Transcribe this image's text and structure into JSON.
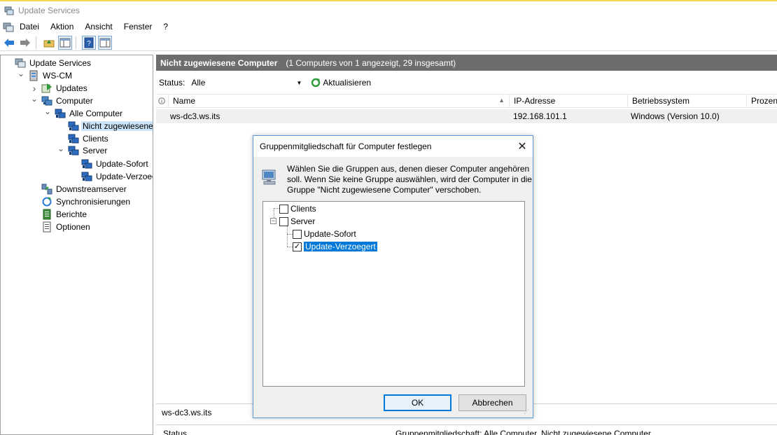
{
  "window": {
    "title": "Update Services"
  },
  "menu": [
    "Datei",
    "Aktion",
    "Ansicht",
    "Fenster",
    "?"
  ],
  "tree": {
    "items": [
      {
        "label": "Update Services",
        "depth": 0,
        "expander": "",
        "icon": "server-console-icon"
      },
      {
        "label": "WS-CM",
        "depth": 1,
        "expander": "expanded",
        "icon": "server-icon"
      },
      {
        "label": "Updates",
        "depth": 2,
        "expander": "collapsed",
        "icon": "updates-icon"
      },
      {
        "label": "Computer",
        "depth": 2,
        "expander": "expanded",
        "icon": "computers-icon"
      },
      {
        "label": "Alle Computer",
        "depth": 3,
        "expander": "expanded",
        "icon": "computer-group-icon"
      },
      {
        "label": "Nicht zugewiesene Co",
        "depth": 4,
        "expander": "",
        "icon": "computer-group-icon",
        "selected": true
      },
      {
        "label": "Clients",
        "depth": 4,
        "expander": "",
        "icon": "computer-group-icon"
      },
      {
        "label": "Server",
        "depth": 4,
        "expander": "expanded",
        "icon": "computer-group-icon",
        "offset": -1
      },
      {
        "label": "Update-Sofort",
        "depth": 5,
        "expander": "",
        "icon": "computer-group-icon"
      },
      {
        "label": "Update-Verzoegert",
        "depth": 5,
        "expander": "",
        "icon": "computer-group-icon"
      },
      {
        "label": "Downstreamserver",
        "depth": 2,
        "expander": "",
        "icon": "downstream-icon"
      },
      {
        "label": "Synchronisierungen",
        "depth": 2,
        "expander": "",
        "icon": "sync-icon"
      },
      {
        "label": "Berichte",
        "depth": 2,
        "expander": "",
        "icon": "reports-icon"
      },
      {
        "label": "Optionen",
        "depth": 2,
        "expander": "",
        "icon": "options-icon"
      }
    ]
  },
  "pane": {
    "title": "Nicht zugewiesene Computer",
    "subtitle": "(1 Computers von 1 angezeigt, 29 insgesamt)",
    "status_label": "Status:",
    "status_value": "Alle",
    "refresh_label": "Aktualisieren",
    "columns": [
      "Name",
      "IP-Adresse",
      "Betriebssystem",
      "Prozen"
    ],
    "rows": [
      {
        "name": "ws-dc3.ws.its",
        "ip": "192.168.101.1",
        "os": "Windows (Version 10.0)"
      }
    ],
    "detail_name": "ws-dc3.ws.its",
    "bottom_left": "Status",
    "bottom_right": "Gruppenmitgliedschaft:    Alle Computer, Nicht zugewiesene Computer"
  },
  "dialog": {
    "title": "Gruppenmitgliedschaft für Computer festlegen",
    "message": "Wählen Sie die Gruppen aus, denen dieser Computer angehören soll. Wenn Sie keine Gruppe auswählen, wird der Computer in die Gruppe \"Nicht zugewiesene Computer\" verschoben.",
    "groups": [
      {
        "label": "Clients",
        "checked": false
      },
      {
        "label": "Server",
        "checked": false
      },
      {
        "label": "Update-Sofort",
        "checked": false
      },
      {
        "label": "Update-Verzoegert",
        "checked": true
      }
    ],
    "ok_label": "OK",
    "cancel_label": "Abbrechen"
  },
  "colors": {
    "accent": "#0078d7",
    "header_band": "#6d6d6d",
    "selection": "#cce4f7"
  }
}
